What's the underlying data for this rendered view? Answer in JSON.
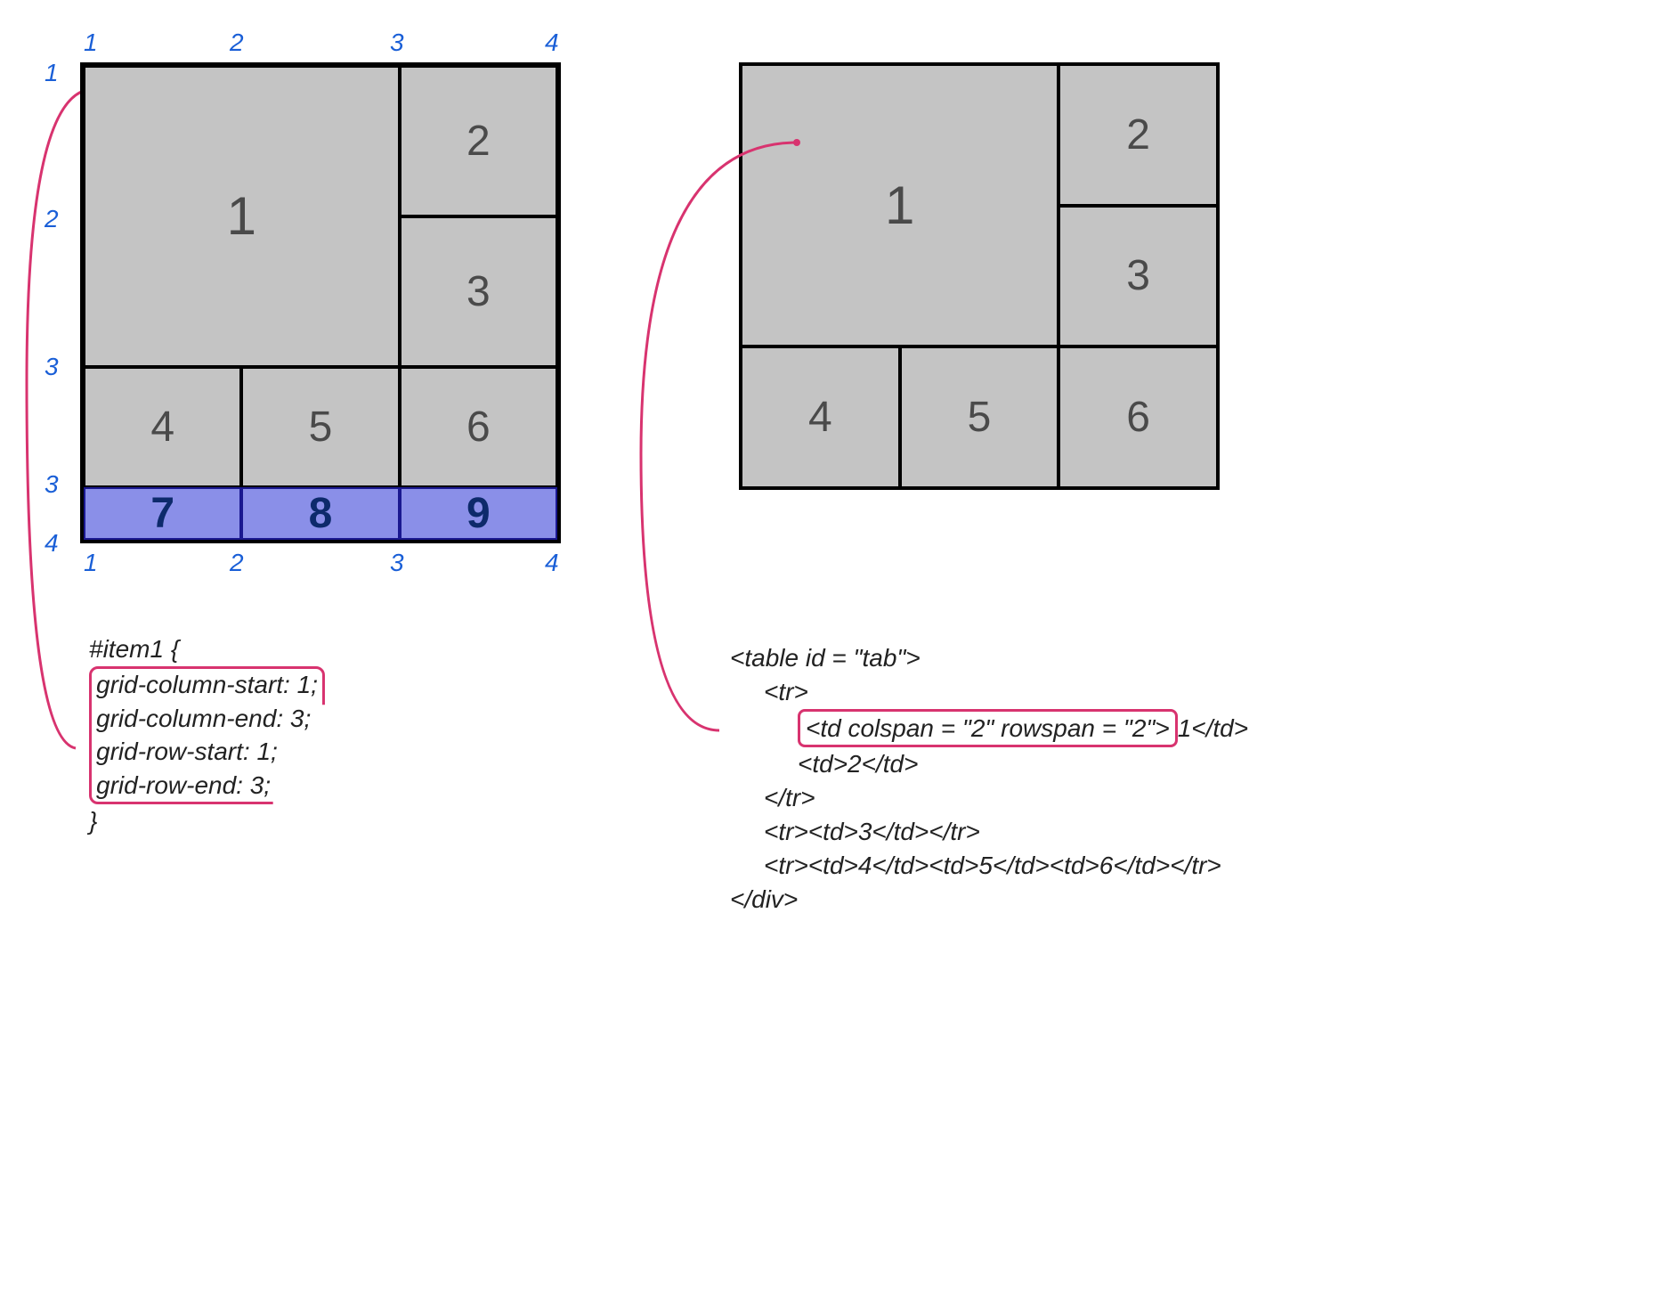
{
  "left": {
    "item_label": "#item1",
    "ticks_top": [
      "1",
      "2",
      "3",
      "4"
    ],
    "ticks_left": [
      "1",
      "2",
      "3",
      "3",
      "4"
    ],
    "ticks_bottom": [
      "1",
      "2",
      "3",
      "4"
    ],
    "cells": {
      "1": "1",
      "2": "2",
      "3": "3",
      "4": "4",
      "5": "5",
      "6": "6",
      "7": "7",
      "8": "8",
      "9": "9"
    },
    "code": {
      "selector": "#item1 {",
      "l1": "grid-column-start: 1;",
      "l2": "grid-column-end: 3;",
      "l3": "grid-row-start: 1;",
      "l4": "grid-row-end: 3;",
      "close": "}"
    }
  },
  "right": {
    "cells": {
      "1": "1",
      "2": "2",
      "3": "3",
      "4": "4",
      "5": "5",
      "6": "6"
    },
    "code": {
      "l1": "<table id = \"tab\">",
      "l2": "<tr>",
      "l3a": "<td colspan = \"2\" rowspan = \"2\">",
      "l3b": "1</td>",
      "l4": "<td>2</td>",
      "l5": "</tr>",
      "l6": "<tr><td>3</td></tr>",
      "l7": "<tr><td>4</td><td>5</td><td>6</td></tr>",
      "l8": "</div>"
    }
  }
}
